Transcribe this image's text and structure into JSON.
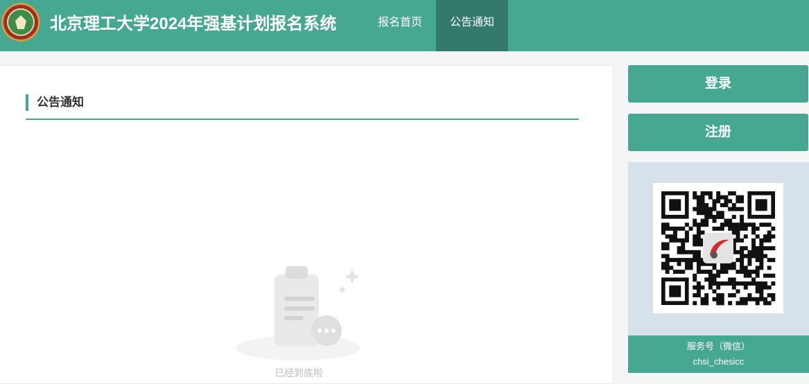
{
  "header": {
    "logo_label": "北京理工大学",
    "site_title": "北京理工大学2024年强基计划报名系统",
    "nav": [
      {
        "label": "报名首页"
      },
      {
        "label": "公告通知"
      }
    ]
  },
  "main": {
    "section_title": "公告通知",
    "empty_state": {
      "icon": "clipboard-empty-icon",
      "text": "已经到底啦"
    }
  },
  "sidebar": {
    "login_label": "登录",
    "register_label": "注册",
    "qr": {
      "caption": "服务号（微信）",
      "account": "chsi_chesicc",
      "icon": "wechat-qr-code"
    }
  },
  "colors": {
    "primary": "#47a891",
    "nav_active": "#337a6c",
    "panel_bg": "#d6e1ea",
    "page_bg": "#f4f5f7"
  }
}
